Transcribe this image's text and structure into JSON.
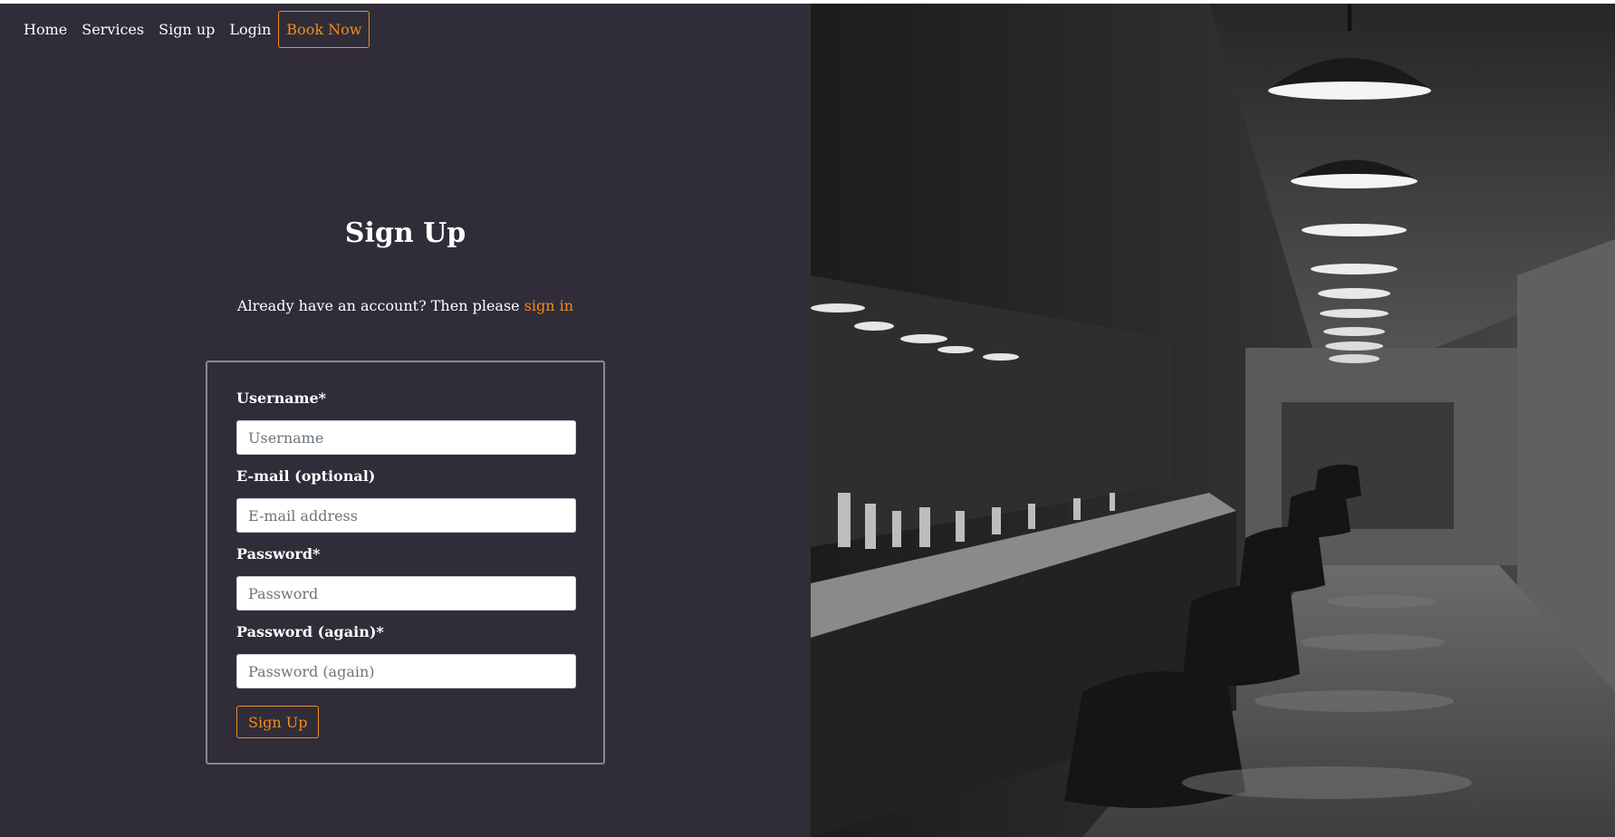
{
  "nav": {
    "items": [
      {
        "label": "Home"
      },
      {
        "label": "Services"
      },
      {
        "label": "Sign up"
      },
      {
        "label": "Login"
      }
    ],
    "book_label": "Book Now"
  },
  "page": {
    "title": "Sign Up",
    "subtitle_prefix": "Already have an account? Then please ",
    "signin_link": "sign in"
  },
  "form": {
    "username": {
      "label": "Username*",
      "placeholder": "Username",
      "value": ""
    },
    "email": {
      "label": "E-mail (optional)",
      "placeholder": "E-mail address",
      "value": ""
    },
    "password": {
      "label": "Password*",
      "placeholder": "Password",
      "value": ""
    },
    "password2": {
      "label": "Password (again)*",
      "placeholder": "Password (again)",
      "value": ""
    },
    "submit_label": "Sign Up"
  },
  "hero_image": {
    "icon": "barbershop-interior-photo"
  },
  "colors": {
    "background": "#302d38",
    "accent": "#f28c1e",
    "text": "#ffffff"
  }
}
